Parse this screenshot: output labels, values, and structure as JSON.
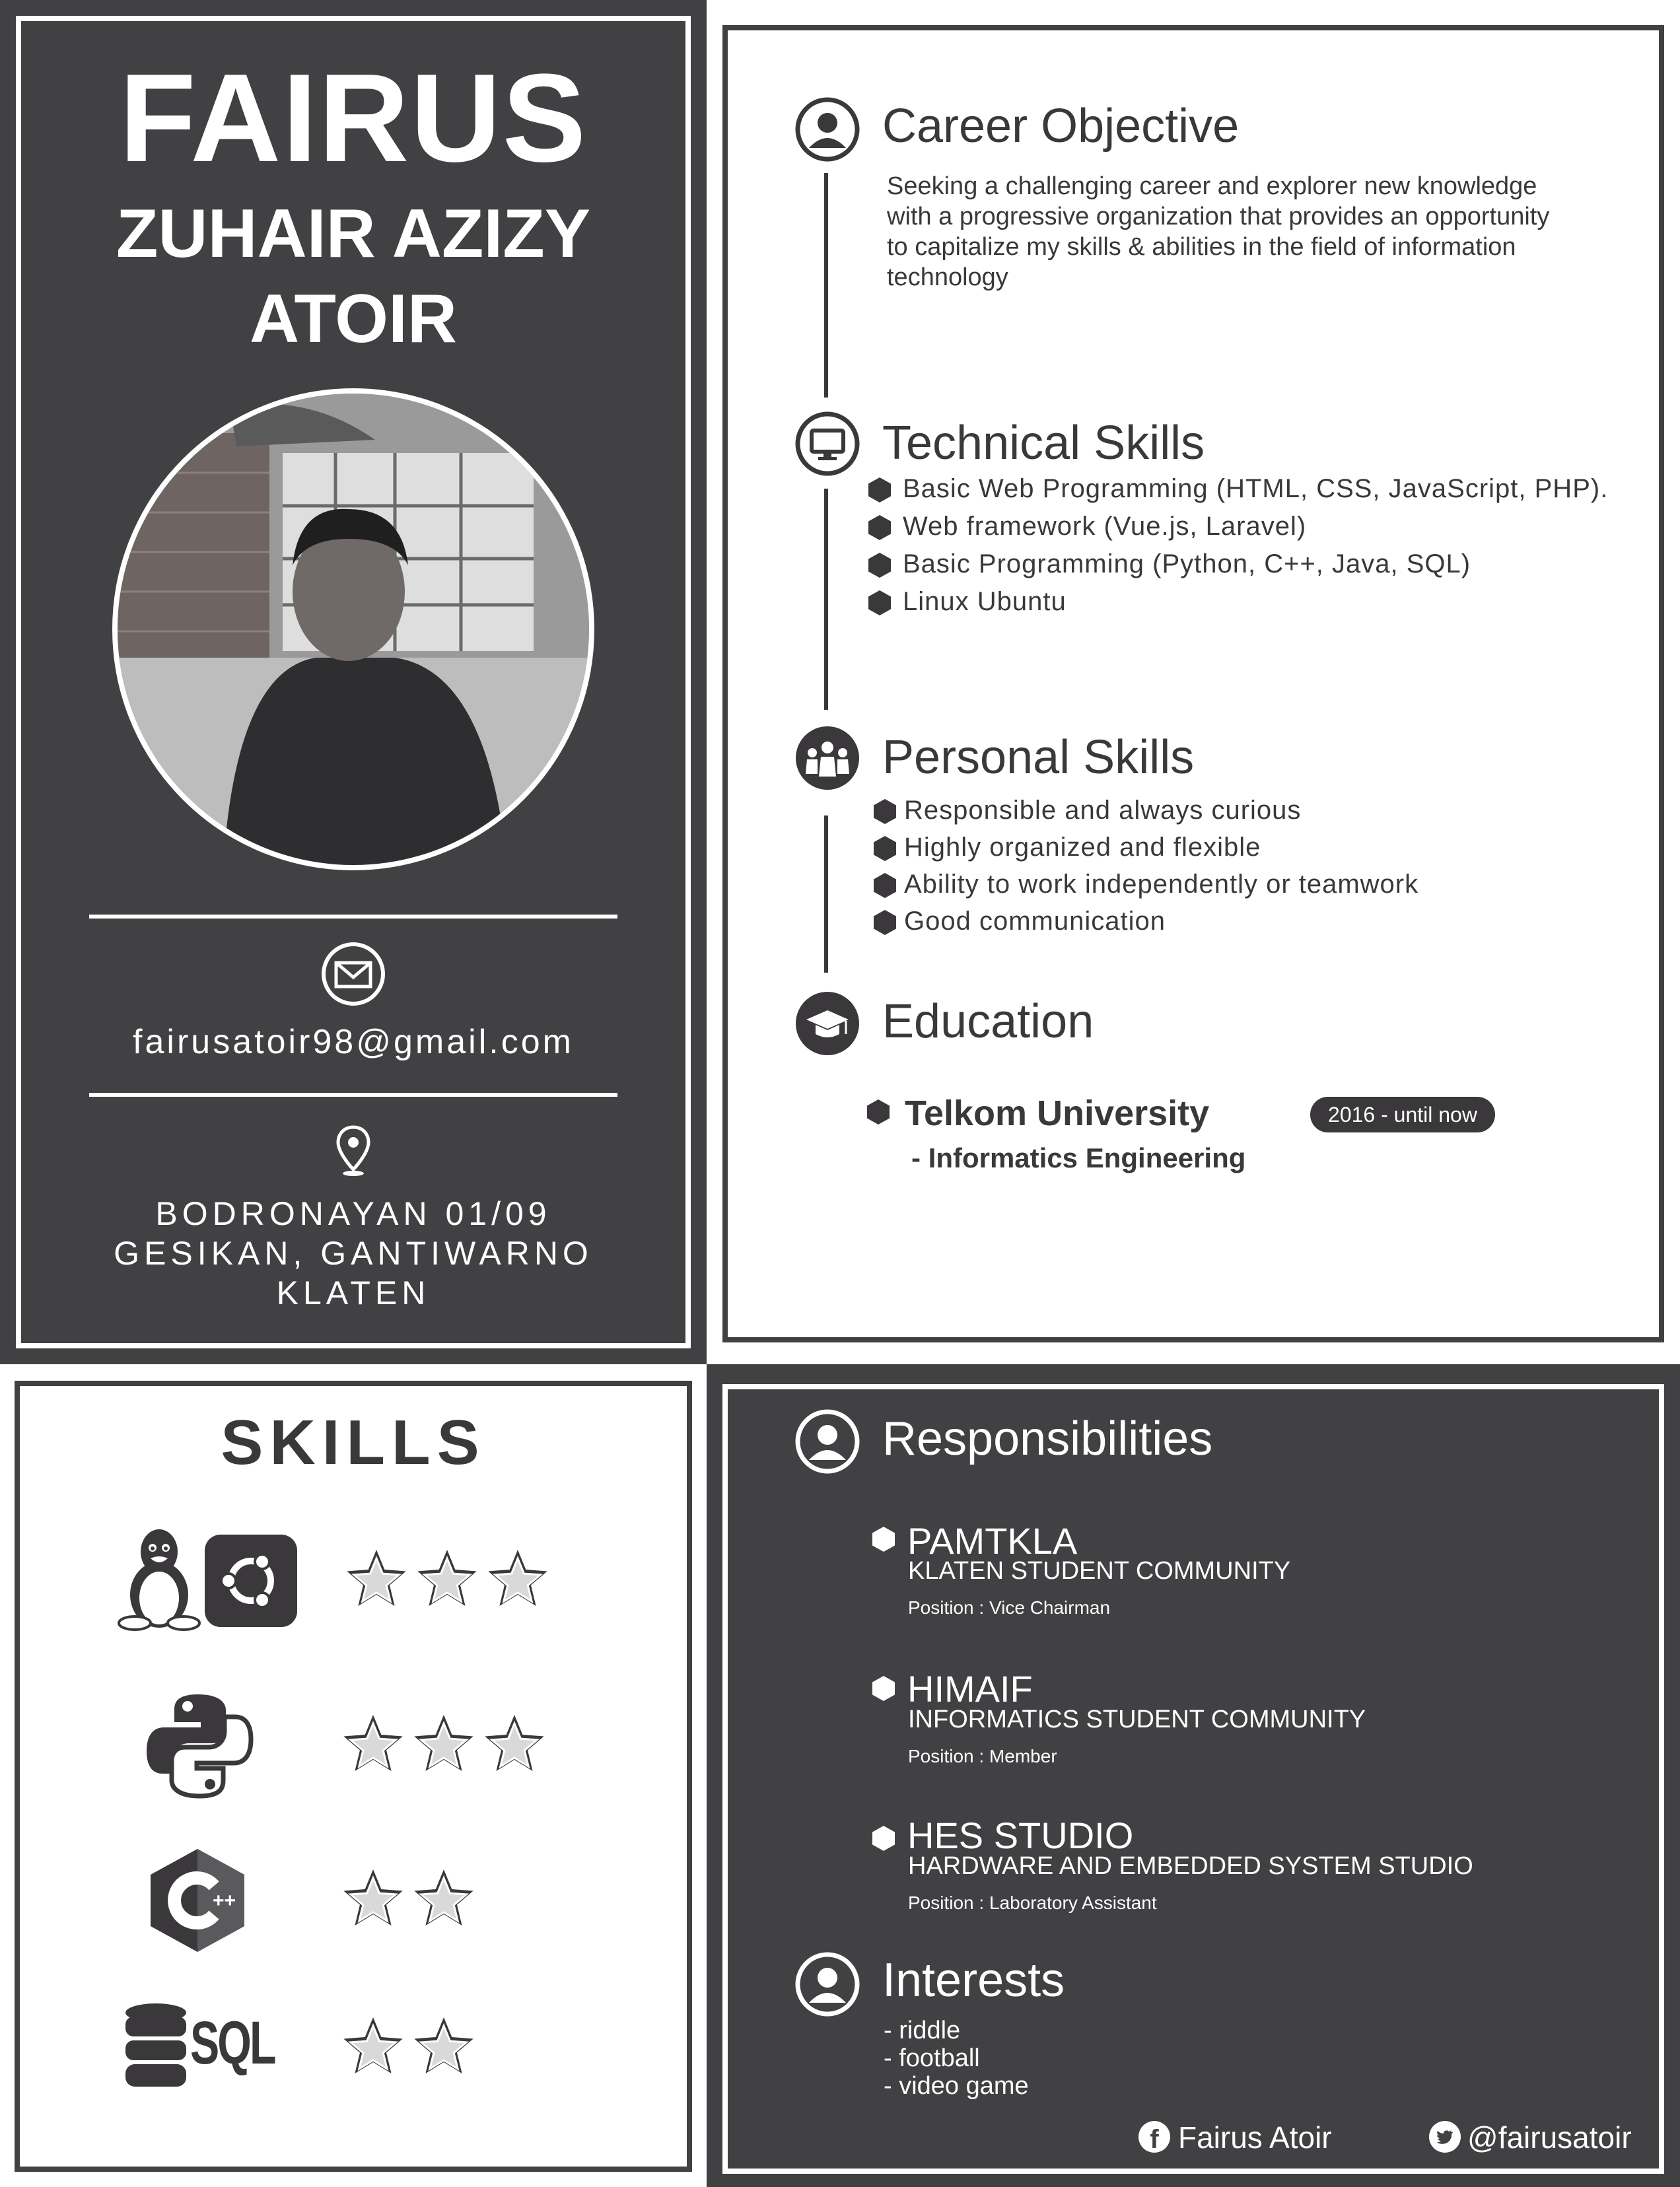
{
  "profile": {
    "first_name": "FAIRUS",
    "name_line2": "ZUHAIR AZIZY",
    "name_line3": "ATOIR",
    "email": "fairusatoir98@gmail.com",
    "address": [
      "BODRONAYAN 01/09",
      "GESIKAN, GANTIWARNO",
      "KLATEN"
    ]
  },
  "career_objective": {
    "title": "Career Objective",
    "text": [
      "Seeking a challenging career and explorer new knowledge",
      "with a progressive organization that provides an opportunity",
      "to capitalize my skills & abilities in the field of information",
      "technology"
    ]
  },
  "technical_skills": {
    "title": "Technical Skills",
    "items": [
      "Basic Web Programming (HTML, CSS, JavaScript, PHP).",
      "Web framework (Vue.js, Laravel)",
      "Basic Programming (Python, C++, Java, SQL)",
      "Linux Ubuntu"
    ]
  },
  "personal_skills": {
    "title": "Personal Skills",
    "items": [
      "Responsible and always curious",
      "Highly organized and flexible",
      "Ability to work independently or teamwork",
      "Good communication"
    ]
  },
  "education": {
    "title": "Education",
    "school": "Telkom University",
    "major": "- Informatics Engineering",
    "period": "2016 - until now"
  },
  "skills": {
    "title": "SKILLS",
    "rows": [
      {
        "icon": "linux-ubuntu-icon",
        "stars": 3
      },
      {
        "icon": "python-icon",
        "stars": 3
      },
      {
        "icon": "cpp-icon",
        "stars": 2
      },
      {
        "icon": "sql-icon",
        "label": "SQL",
        "stars": 2
      }
    ]
  },
  "responsibilities": {
    "title": "Responsibilities",
    "items": [
      {
        "name": "PAMTKLA",
        "subtitle": "KLATEN STUDENT COMMUNITY",
        "position": "Position : Vice Chairman"
      },
      {
        "name": "HIMAIF",
        "subtitle": "INFORMATICS STUDENT COMMUNITY",
        "position": "Position : Member"
      },
      {
        "name": "HES STUDIO",
        "subtitle": "HARDWARE AND EMBEDDED SYSTEM STUDIO",
        "position": "Position : Laboratory Assistant"
      }
    ]
  },
  "interests": {
    "title": "Interests",
    "items": [
      "- riddle",
      "- football",
      "- video game"
    ]
  },
  "social": {
    "facebook": "Fairus Atoir",
    "twitter": "@fairusatoir"
  },
  "colors": {
    "dark": "#414042",
    "text": "#3a383a",
    "light": "#ffffff"
  }
}
